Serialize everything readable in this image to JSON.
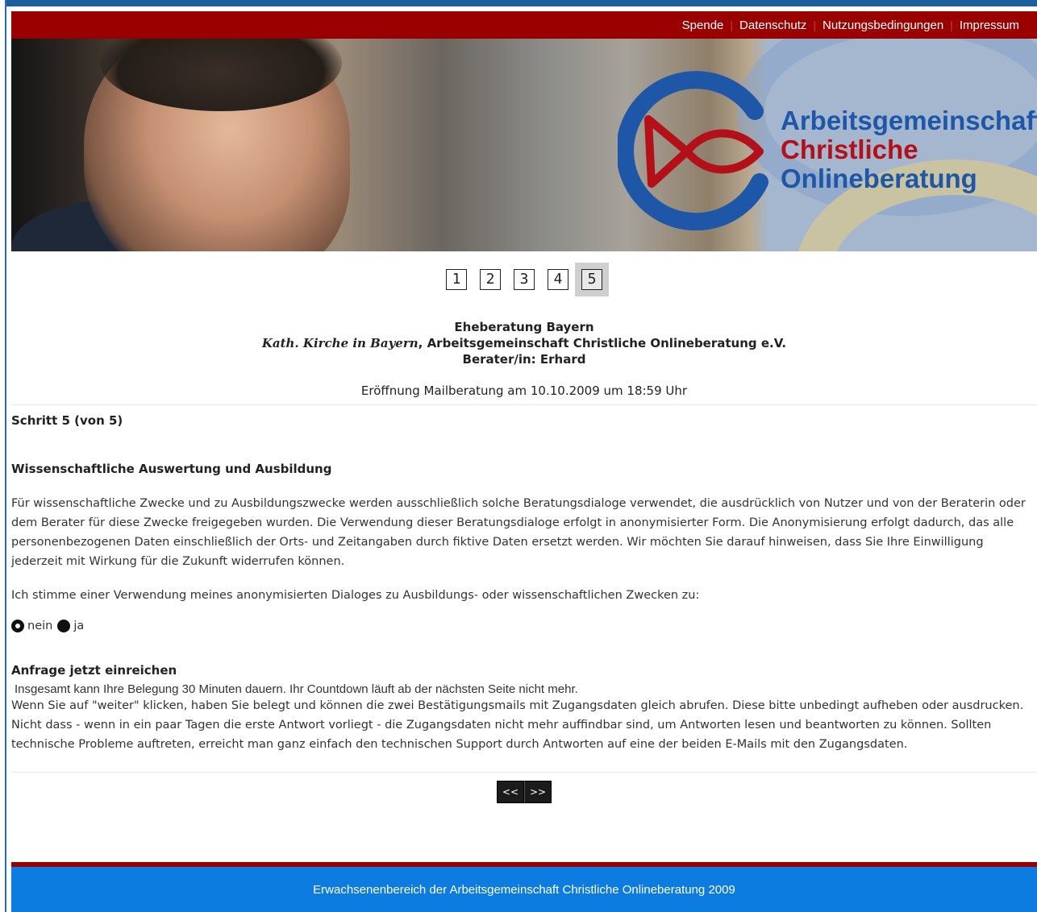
{
  "topnav": {
    "links": [
      "Spende",
      "Datenschutz",
      "Nutzungsbedingungen",
      "Impressum"
    ]
  },
  "banner": {
    "logo_text": [
      "Arbeitsgemeinschaft",
      "Christliche",
      "Onlineberatung"
    ]
  },
  "steps": {
    "items": [
      "1",
      "2",
      "3",
      "4",
      "5"
    ],
    "active": "5"
  },
  "info": {
    "title": "Eheberatung Bayern",
    "org_italic": "Kath. Kirche in Bayern",
    "org_rest": ", Arbeitsgemeinschaft Christliche Onlineberatung e.V.",
    "counselor": "Berater/in: Erhard",
    "opened": "Eröffnung Mailberatung am 10.10.2009 um 18:59 Uhr"
  },
  "content": {
    "step_heading": "Schritt 5 (von 5)",
    "section_heading": "Wissenschaftliche Auswertung und Ausbildung",
    "paragraph": "Für wissenschaftliche Zwecke und zu Ausbildungszwecke werden ausschließlich solche Beratungsdialoge verwendet, die ausdrücklich von Nutzer und von der Beraterin oder dem Berater für diese Zwecke freigegeben wurden. Die Verwendung dieser Beratungsdialoge erfolgt in anonymisierter Form. Die Anonymisierung erfolgt dadurch, das alle personenbezogenen Daten einschließlich der Orts- und Zeitangaben durch fiktive Daten ersetzt werden. Wir möchten Sie darauf hinweisen, dass Sie Ihre Einwilligung jederzeit mit Wirkung für die Zukunft widerrufen können.",
    "consent_question": "Ich stimme einer Verwendung meines anonymisierten Dialoges zu Ausbildungs- oder wissenschaftlichen Zwecken zu:",
    "radio_no": "nein",
    "radio_yes": "ja",
    "submit_heading": "Anfrage jetzt einreichen",
    "notice": "Insgesamt kann Ihre Belegung 30 Minuten dauern. Ihr Countdown läuft ab der nächsten Seite nicht mehr.",
    "paragraph2": "Wenn Sie auf \"weiter\" klicken, haben Sie belegt und können die zwei Bestätigungsmails mit Zugangsdaten gleich abrufen. Diese bitte unbedingt aufheben oder ausdrucken. Nicht dass - wenn in ein paar Tagen die erste Antwort vorliegt - die Zugangsdaten nicht mehr auffindbar sind, um Antworten lesen und beantworten zu können. Sollten technische Probleme auftreten, erreicht man ganz einfach den technischen Support durch Antworten auf eine der beiden E-Mails mit den Zugangsdaten."
  },
  "nav": {
    "back": "<<",
    "next": ">>"
  },
  "footer": {
    "text": "Erwachsenenbereich der Arbeitsgemeinschaft Christliche Onlineberatung 2009"
  },
  "colors": {
    "topbar": "#9b0000",
    "footer": "#0d7ce0",
    "logo_blue": "#1f57a8",
    "logo_red": "#b3101a"
  }
}
